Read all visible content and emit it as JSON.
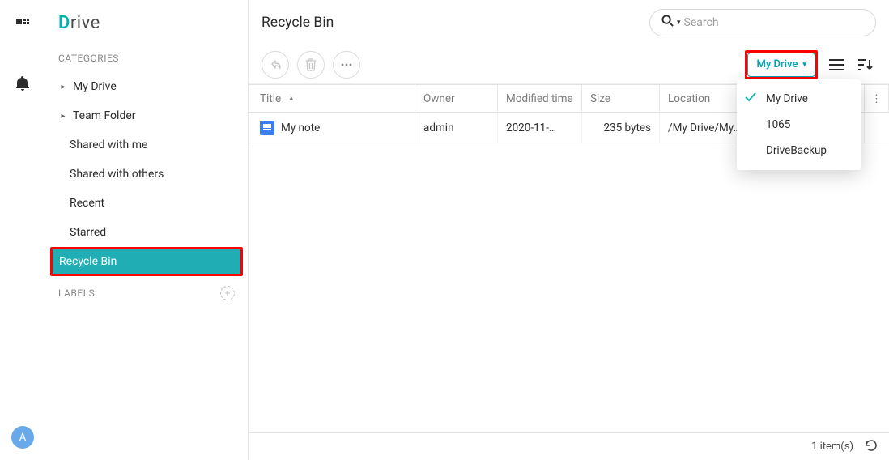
{
  "app_name": "Drive",
  "avatar_initial": "A",
  "sidebar": {
    "categories_label": "CATEGORIES",
    "labels_label": "LABELS",
    "items": [
      {
        "label": "My Drive",
        "expandable": true
      },
      {
        "label": "Team Folder",
        "expandable": true
      },
      {
        "label": "Shared with me",
        "expandable": false
      },
      {
        "label": "Shared with others",
        "expandable": false
      },
      {
        "label": "Recent",
        "expandable": false
      },
      {
        "label": "Starred",
        "expandable": false
      },
      {
        "label": "Recycle Bin",
        "expandable": false,
        "selected": true
      }
    ]
  },
  "header": {
    "title": "Recycle Bin",
    "search_placeholder": "Search"
  },
  "toolbar": {
    "drive_selector_label": "My Drive",
    "drive_selector_options": [
      {
        "label": "My Drive",
        "selected": true
      },
      {
        "label": "1065",
        "selected": false
      },
      {
        "label": "DriveBackup",
        "selected": false
      }
    ]
  },
  "table": {
    "columns": {
      "title": "Title",
      "owner": "Owner",
      "modified_time": "Modified time",
      "size": "Size",
      "location": "Location"
    },
    "sort_column": "title",
    "sort_direction": "asc",
    "rows": [
      {
        "title": "My note",
        "owner": "admin",
        "modified_time": "2020-11-…",
        "size": "235 bytes",
        "location": "/My Drive/My…"
      }
    ]
  },
  "status": {
    "items_label": "1 item(s)"
  }
}
